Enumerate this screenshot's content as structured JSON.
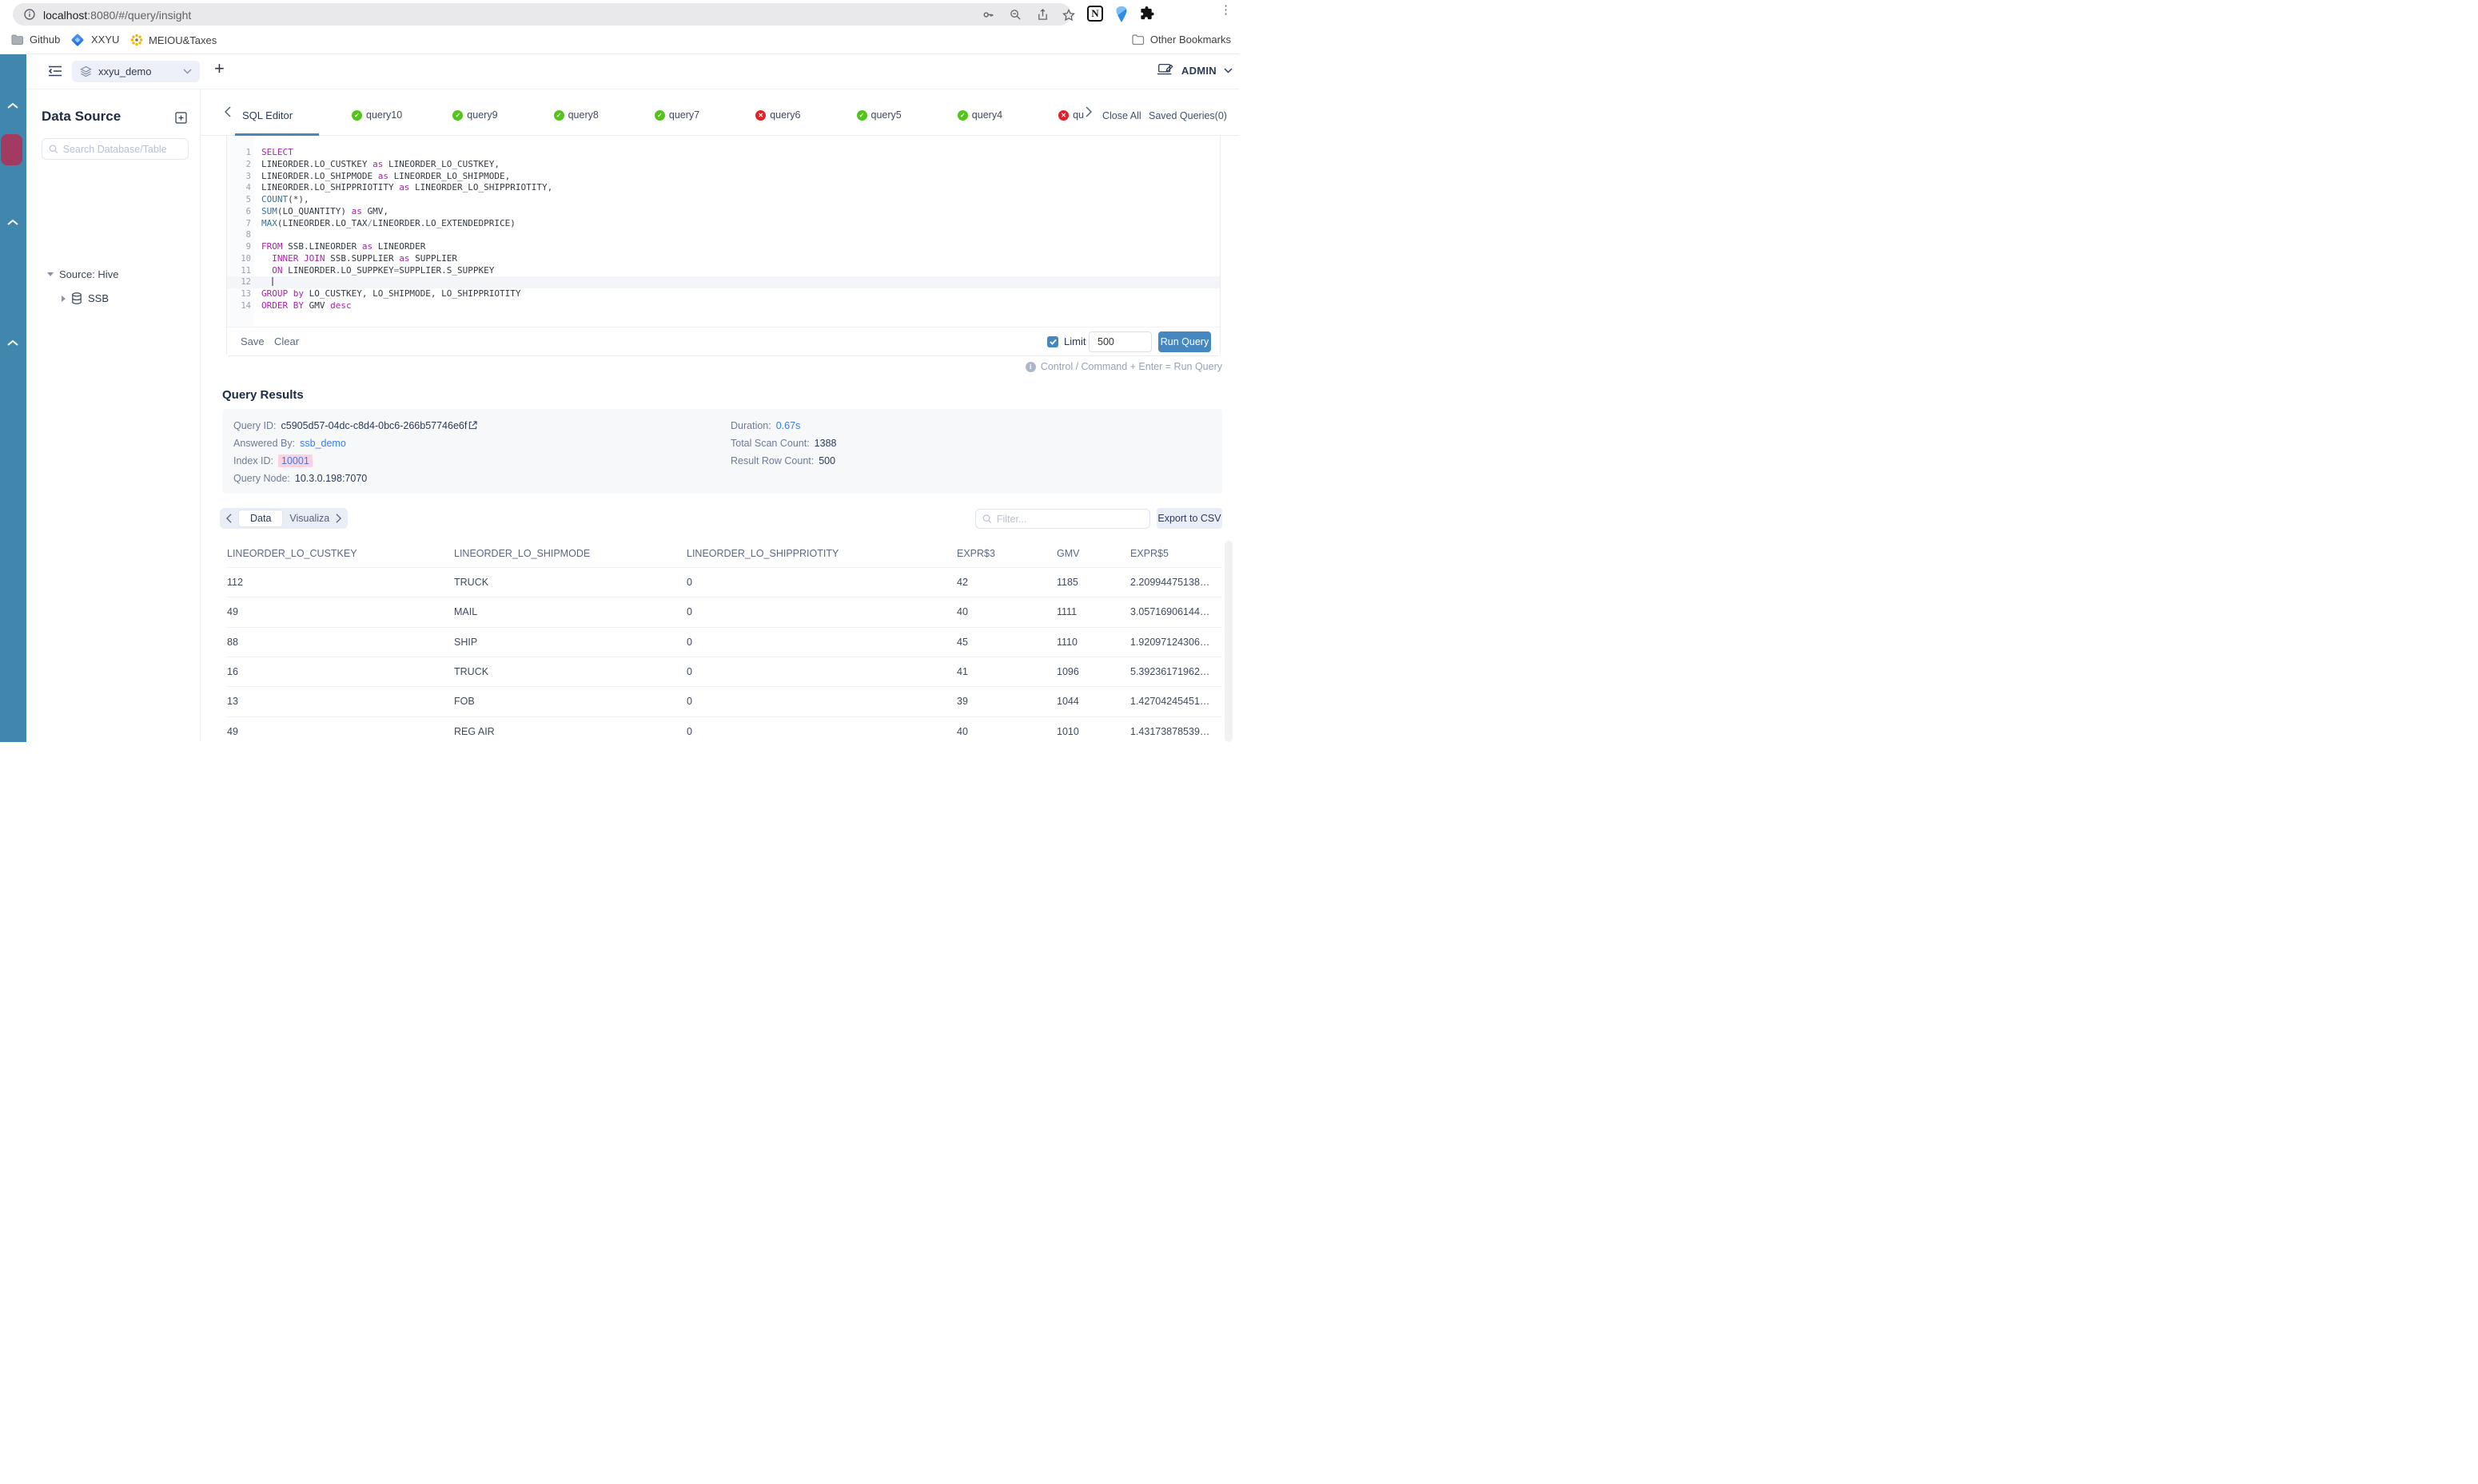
{
  "browser": {
    "url_host": "localhost",
    "url_rest": ":8080/#/query/insight",
    "notion_letter": "N",
    "kebab": "⋮"
  },
  "bookmarks": {
    "items": [
      {
        "label": "Github",
        "icon": "folder"
      },
      {
        "label": "XXYU",
        "icon": "blue-diamond"
      },
      {
        "label": "MEIOU&Taxes",
        "icon": "yellow-flower"
      }
    ],
    "other_label": "Other Bookmarks"
  },
  "topbar": {
    "workspace": "xxyu_demo",
    "add_label": "+",
    "admin_label": "ADMIN"
  },
  "datasource": {
    "title": "Data Source",
    "search_placeholder": "Search Database/Table",
    "source_label": "Source: Hive",
    "table_label": "SSB"
  },
  "tabs": {
    "editor_label": "SQL Editor",
    "queries": [
      {
        "label": "query10",
        "status": "ok"
      },
      {
        "label": "query9",
        "status": "ok"
      },
      {
        "label": "query8",
        "status": "ok"
      },
      {
        "label": "query7",
        "status": "ok"
      },
      {
        "label": "query6",
        "status": "error"
      },
      {
        "label": "query5",
        "status": "ok"
      },
      {
        "label": "query4",
        "status": "ok"
      },
      {
        "label": "qu",
        "status": "error",
        "truncated": true
      }
    ],
    "close_all": "Close All",
    "saved_queries": "Saved Queries(0)"
  },
  "icons": {
    "success": "✓",
    "error": "✕"
  },
  "editor": {
    "lines": [
      {
        "n": 1,
        "segs": [
          [
            "k",
            "SELECT"
          ]
        ]
      },
      {
        "n": 2,
        "segs": [
          [
            "t",
            "LINEORDER.LO_CUSTKEY "
          ],
          [
            "k",
            "as"
          ],
          [
            "t",
            " LINEORDER_LO_CUSTKEY,"
          ]
        ]
      },
      {
        "n": 3,
        "segs": [
          [
            "t",
            "LINEORDER.LO_SHIPMODE "
          ],
          [
            "k",
            "as"
          ],
          [
            "t",
            " LINEORDER_LO_SHIPMODE,"
          ]
        ]
      },
      {
        "n": 4,
        "segs": [
          [
            "t",
            "LINEORDER.LO_SHIPPRIOTITY "
          ],
          [
            "k",
            "as"
          ],
          [
            "t",
            " LINEORDER_LO_SHIPPRIOTITY,"
          ]
        ]
      },
      {
        "n": 5,
        "segs": [
          [
            "f",
            "COUNT"
          ],
          [
            "t",
            "(*),"
          ]
        ]
      },
      {
        "n": 6,
        "segs": [
          [
            "f",
            "SUM"
          ],
          [
            "t",
            "(LO_QUANTITY) "
          ],
          [
            "k",
            "as"
          ],
          [
            "t",
            " GMV,"
          ]
        ]
      },
      {
        "n": 7,
        "segs": [
          [
            "f",
            "MAX"
          ],
          [
            "t",
            "(LINEORDER.LO_TAX"
          ],
          [
            "o",
            "/"
          ],
          [
            "t",
            "LINEORDER.LO_EXTENDEDPRICE)"
          ]
        ]
      },
      {
        "n": 8,
        "segs": []
      },
      {
        "n": 9,
        "segs": [
          [
            "k",
            "FROM"
          ],
          [
            "t",
            " SSB.LINEORDER "
          ],
          [
            "k",
            "as"
          ],
          [
            "t",
            " LINEORDER"
          ]
        ]
      },
      {
        "n": 10,
        "segs": [
          [
            "t",
            "  "
          ],
          [
            "k",
            "INNER JOIN"
          ],
          [
            "t",
            " SSB.SUPPLIER "
          ],
          [
            "k",
            "as"
          ],
          [
            "t",
            " SUPPLIER"
          ]
        ]
      },
      {
        "n": 11,
        "segs": [
          [
            "t",
            "  "
          ],
          [
            "k",
            "ON"
          ],
          [
            "t",
            " LINEORDER.LO_SUPPKEY"
          ],
          [
            "o",
            "="
          ],
          [
            "t",
            "SUPPLIER.S_SUPPKEY"
          ]
        ]
      },
      {
        "n": 12,
        "segs": [
          [
            "t",
            "  "
          ],
          [
            "c",
            ""
          ]
        ],
        "active": true
      },
      {
        "n": 13,
        "segs": [
          [
            "k",
            "GROUP by"
          ],
          [
            "t",
            " LO_CUSTKEY, LO_SHIPMODE, LO_SHIPPRIOTITY"
          ]
        ]
      },
      {
        "n": 14,
        "segs": [
          [
            "k",
            "ORDER BY"
          ],
          [
            "t",
            " GMV "
          ],
          [
            "k",
            "desc"
          ]
        ]
      }
    ]
  },
  "editor_toolbar": {
    "save": "Save",
    "clear": "Clear",
    "limit_label": "Limit",
    "limit_value": "500",
    "run": "Run Query",
    "hint": "Control / Command + Enter = Run Query",
    "hint_icon": "i"
  },
  "results": {
    "title": "Query Results",
    "query_id_label": "Query ID:",
    "query_id": "c5905d57-04dc-c8d4-0bc6-266b57746e6f",
    "answered_by_label": "Answered By:",
    "answered_by": "ssb_demo",
    "index_id_label": "Index ID:",
    "index_id": "10001",
    "query_node_label": "Query Node:",
    "query_node": "10.3.0.198:7070",
    "duration_label": "Duration:",
    "duration": "0.67s",
    "scan_label": "Total Scan Count:",
    "scan_count": "1388",
    "row_label": "Result Row Count:",
    "row_count": "500",
    "view_tab_data": "Data",
    "view_tab_viz": "Visualiza",
    "filter_placeholder": "Filter...",
    "export_label": "Export to CSV"
  },
  "table": {
    "columns": [
      "LINEORDER_LO_CUSTKEY",
      "LINEORDER_LO_SHIPMODE",
      "LINEORDER_LO_SHIPPRIOTITY",
      "EXPR$3",
      "GMV",
      "EXPR$5"
    ],
    "rows": [
      [
        "112",
        "TRUCK",
        "0",
        "42",
        "1185",
        "2.20994475138…"
      ],
      [
        "49",
        "MAIL",
        "0",
        "40",
        "1111",
        "3.05716906144…"
      ],
      [
        "88",
        "SHIP",
        "0",
        "45",
        "1110",
        "1.92097124306…"
      ],
      [
        "16",
        "TRUCK",
        "0",
        "41",
        "1096",
        "5.39236171962…"
      ],
      [
        "13",
        "FOB",
        "0",
        "39",
        "1044",
        "1.42704245451…"
      ],
      [
        "49",
        "REG AIR",
        "0",
        "40",
        "1010",
        "1.43173878539…"
      ]
    ]
  },
  "colors": {
    "accent_blue": "#4687bf",
    "rail_blue": "#4187ad",
    "rail_active_maroon": "#a13b62",
    "link_blue": "#3b7de2",
    "success_green": "#52c41a",
    "error_red": "#e02129",
    "keyword_magenta": "#a626a4",
    "function_blue": "#39708f",
    "index_highlight_pink": "#fad2e2"
  }
}
